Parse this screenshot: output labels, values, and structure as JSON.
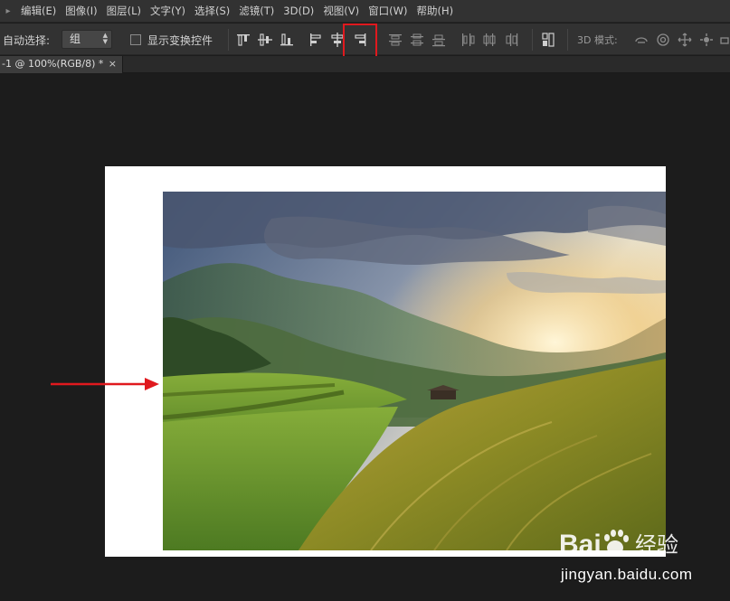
{
  "menubar": {
    "items": [
      {
        "label": "编辑(E)"
      },
      {
        "label": "图像(I)"
      },
      {
        "label": "图层(L)"
      },
      {
        "label": "文字(Y)"
      },
      {
        "label": "选择(S)"
      },
      {
        "label": "滤镜(T)"
      },
      {
        "label": "3D(D)"
      },
      {
        "label": "视图(V)"
      },
      {
        "label": "窗口(W)"
      },
      {
        "label": "帮助(H)"
      }
    ]
  },
  "options_bar": {
    "auto_select_label": "自动选择:",
    "auto_select_value": "组",
    "show_transform_label": "显示变换控件",
    "show_transform_checked": false,
    "mode_label": "3D 模式:"
  },
  "document_tab": {
    "title": "-1 @ 100%(RGB/8) *",
    "close": "×"
  },
  "colors": {
    "highlight": "#e0191e",
    "arrow": "#e0191e",
    "canvas_background": "#ffffff",
    "workspace": "#1c1c1c"
  },
  "watermark": {
    "logo_text": "Bai  经验",
    "url": "jingyan.baidu.com"
  }
}
